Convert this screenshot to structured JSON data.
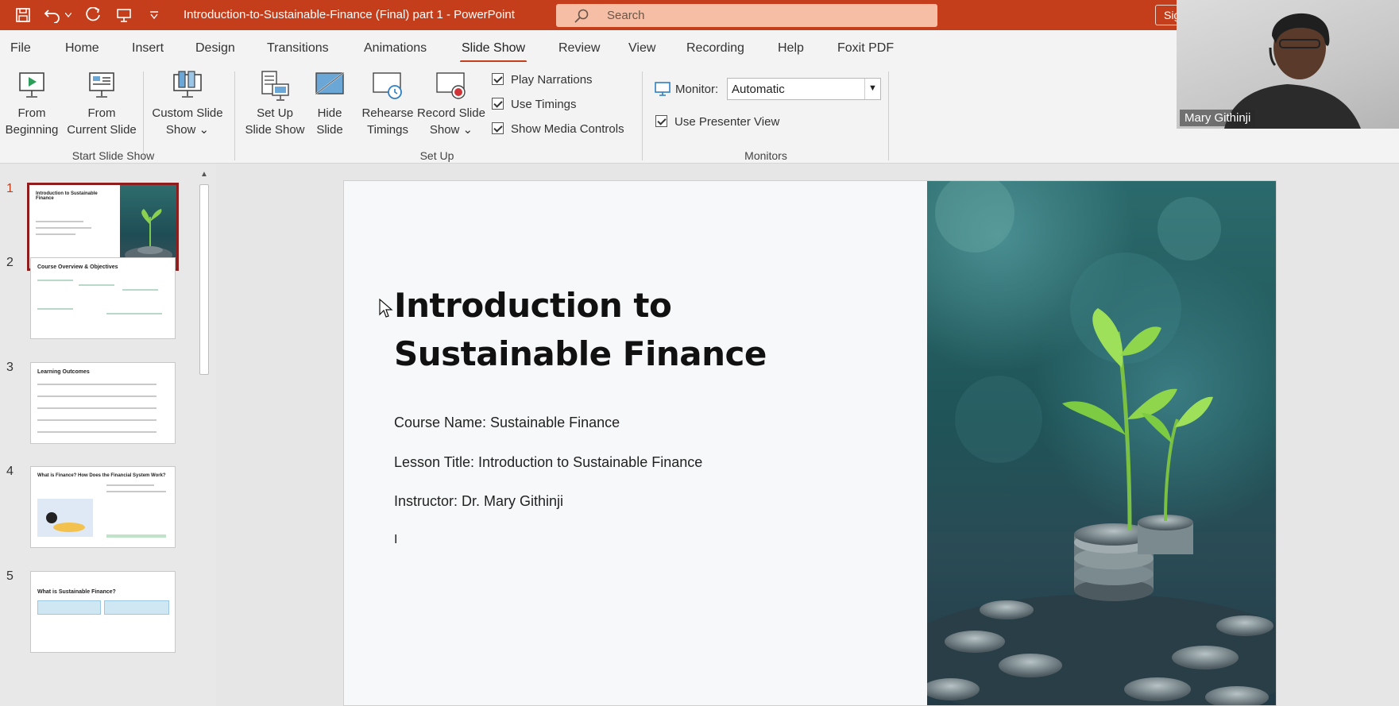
{
  "titlebar": {
    "title": "Introduction-to-Sustainable-Finance (Final) part 1  -  PowerPoint",
    "search_placeholder": "Search",
    "signin_label": "Sign in",
    "quick_access": [
      "save-icon",
      "undo-icon",
      "redo-icon",
      "present-icon",
      "customize-icon"
    ]
  },
  "menu": {
    "tabs": [
      {
        "label": "File"
      },
      {
        "label": "Home"
      },
      {
        "label": "Insert"
      },
      {
        "label": "Design"
      },
      {
        "label": "Transitions"
      },
      {
        "label": "Animations"
      },
      {
        "label": "Slide Show",
        "active": true
      },
      {
        "label": "Review"
      },
      {
        "label": "View"
      },
      {
        "label": "Recording"
      },
      {
        "label": "Help"
      },
      {
        "label": "Foxit PDF"
      }
    ]
  },
  "ribbon": {
    "start": {
      "from_beginning": [
        "From",
        "Beginning"
      ],
      "from_current": [
        "From",
        "Current Slide"
      ],
      "custom": [
        "Custom Slide",
        "Show ⌄"
      ],
      "group_label": "Start Slide Show"
    },
    "setup": {
      "setup_show": [
        "Set Up",
        "Slide Show"
      ],
      "hide_slide": [
        "Hide",
        "Slide"
      ],
      "rehearse": [
        "Rehearse",
        "Timings"
      ],
      "record": [
        "Record Slide",
        "Show ⌄"
      ],
      "play_narrations": "Play Narrations",
      "use_timings": "Use Timings",
      "show_media_controls": "Show Media Controls",
      "group_label": "Set Up"
    },
    "monitors": {
      "monitor_label": "Monitor:",
      "monitor_value": "Automatic",
      "presenter_view": "Use Presenter View",
      "group_label": "Monitors"
    }
  },
  "video": {
    "participant_name": "Mary Githinji"
  },
  "thumbnails": [
    {
      "num": "1",
      "title": "Introduction to Sustainable Finance"
    },
    {
      "num": "2",
      "title": "Course Overview & Objectives"
    },
    {
      "num": "3",
      "title": "Learning Outcomes"
    },
    {
      "num": "4",
      "title": "What is Finance? How Does the Financial System Work?"
    },
    {
      "num": "5",
      "title": "What is Sustainable Finance?"
    }
  ],
  "slide": {
    "title": "Introduction to Sustainable Finance",
    "course_name": "Course Name: Sustainable Finance",
    "lesson_title": "Lesson Title: Introduction to Sustainable Finance",
    "instructor": "Instructor: Dr. Mary Githinji",
    "text_cursor": "I"
  }
}
